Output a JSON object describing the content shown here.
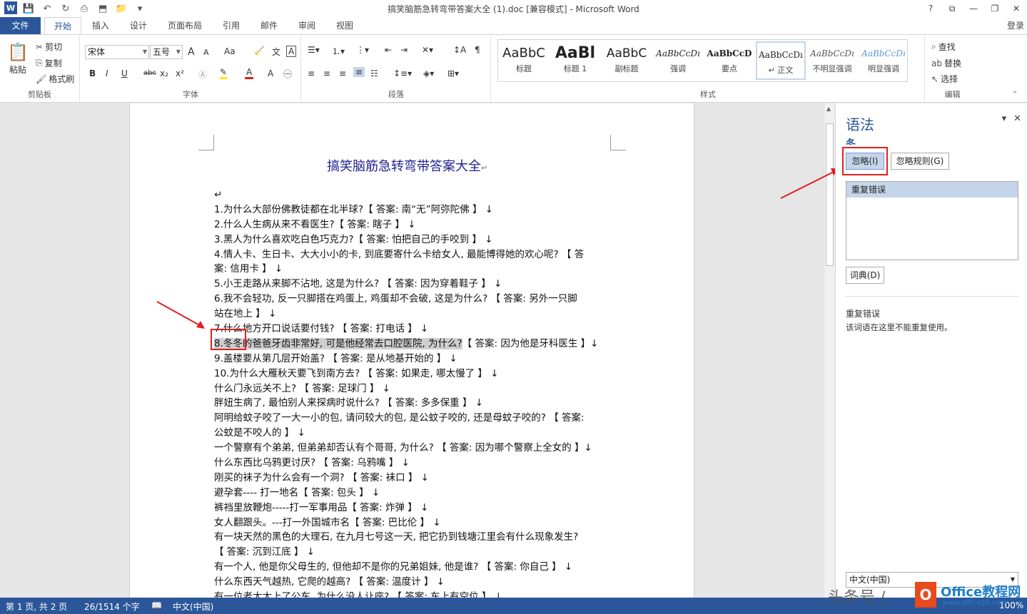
{
  "app": {
    "title": "搞笑脑筋急转弯带答案大全 (1).doc [兼容模式] - Microsoft Word",
    "window_controls": [
      "?",
      "⧉",
      "—",
      "❐",
      "✕"
    ],
    "login": "登录"
  },
  "tabs": [
    "文件",
    "开始",
    "插入",
    "设计",
    "页面布局",
    "引用",
    "邮件",
    "审阅",
    "视图"
  ],
  "ribbon": {
    "clipboard": {
      "paste": "粘贴",
      "cut": "剪切",
      "copy": "复制",
      "format_painter": "格式刷",
      "label": "剪贴板"
    },
    "font": {
      "name": "宋体",
      "size": "五号",
      "case": "Aa",
      "label": "字体",
      "fmt": [
        "B",
        "I",
        "U",
        "abc",
        "x₂",
        "x²"
      ],
      "grow": "A",
      "shrink": "A",
      "font_color": "A"
    },
    "paragraph": {
      "label": "段落"
    },
    "styles": {
      "label": "样式",
      "items": [
        {
          "sample": "AaBbC",
          "name": "标题"
        },
        {
          "sample": "AaBl",
          "name": "标题 1"
        },
        {
          "sample": "AaBbC",
          "name": "副标题"
        },
        {
          "sample": "AaBbCcDı",
          "name": "强调"
        },
        {
          "sample": "AaBbCcD",
          "name": "要点"
        },
        {
          "sample": "AaBbCcDı",
          "name": "↵ 正文"
        },
        {
          "sample": "AaBbCcDı",
          "name": "不明显强调"
        },
        {
          "sample": "AaBbCcDı",
          "name": "明显强调"
        }
      ]
    },
    "editing": {
      "find": "查找",
      "replace": "替换",
      "select": "选择",
      "label": "编辑"
    }
  },
  "document": {
    "heading": "搞笑脑筋急转弯带答案大全",
    "lines": [
      "↵",
      "1.为什么大部份佛教徒都在北半球?【 答案: 南“无”阿弥陀佛 】 ↓",
      "2.什么人生病从来不看医生?【 答案: 瞎子 】 ↓",
      "3.黑人为什么喜欢吃白色巧克力?【 答案: 怕把自己的手咬到 】 ↓",
      "4.情人卡、生日卡、大大小小的卡, 到底要寄什么卡给女人, 最能博得她的欢心呢? 【 答",
      "案: 信用卡 】 ↓",
      "5.小王走路从来脚不沾地, 这是为什么? 【 答案: 因为穿着鞋子 】 ↓",
      "6.我不会轻功, 反一只脚搭在鸡蛋上, 鸡蛋却不会破, 这是为什么? 【 答案: 另外一只脚",
      "站在地上 】 ↓",
      "7.什么地方开口说话要付钱? 【 答案: 打电话 】 ↓",
      "8.冬冬的爸爸牙齿非常好, 可是他经常去口腔医院, 为什么? 【 答案: 因为他是牙科医生 】↓",
      "9.盖楼要从第几层开始盖? 【 答案: 是从地基开始的 】 ↓",
      "10.为什么大雁秋天要飞到南方去? 【 答案: 如果走, 哪太慢了 】 ↓",
      "什么门永远关不上? 【 答案: 足球门 】 ↓",
      "胖妞生病了, 最怕别人来探病时说什么? 【 答案: 多多保重 】 ↓",
      "阿明给蚊子咬了一大一小的包, 请问较大的包, 是公蚊子咬的, 还是母蚊子咬的? 【 答案:",
      "公蚊是不咬人的 】 ↓",
      "一个警察有个弟弟, 但弟弟却否认有个哥哥, 为什么? 【 答案: 因为哪个警察上全女的 】↓",
      "什么东西比乌鸦更讨厌? 【 答案: 乌鸦嘴 】 ↓",
      "刚买的袜子为什么会有一个洞? 【 答案: 袜口 】 ↓",
      "避孕套---- 打一地名【 答案: 包头 】 ↓",
      "裤裆里放鞭炮-----打一军事用品【 答案: 炸弹 】 ↓",
      "女人翻跟头。---打一外国城市名【 答案: 巴比伦 】 ↓",
      "有一块天然的黑色的大理石, 在九月七号这一天, 把它扔到钱塘江里会有什么现象发生?",
      "【 答案: 沉到江底 】 ↓",
      "有一个人, 他是你父母生的, 但他却不是你的兄弟姐妹, 他是谁? 【 答案: 你自己 】 ↓",
      "什么东西天气越热, 它爬的越高? 【 答案: 温度计 】 ↓",
      "有一位老太太上了公车, 为什么没人让座? 【 答案: 车上有空位 】 ↓"
    ],
    "highlight_line_text": "8.冬冬的爸爸牙齿非常好, 可是他经常去口腔医院, 为什么?",
    "highlight_line_rest": "【 答案: 因为他是牙科医生 】↓"
  },
  "pane": {
    "title": "语法",
    "word": "冬",
    "ignore": "忽略(I)",
    "ignore_rule": "忽略规则(G)",
    "suggestion": "重复错误",
    "dictionary": "词典(D)",
    "explain_title": "重复错误",
    "explain_text": "该词语在这里不能重复使用。",
    "language": "中文(中国)"
  },
  "status": {
    "page": "第 1 页, 共 2 页",
    "words": "26/1514 个字",
    "lang": "中文(中国)",
    "zoom": "100%"
  },
  "watermark": {
    "text1": "头条号 /",
    "text2": "Office教程网",
    "url": "www.office26.com"
  },
  "colors": {
    "accent": "#2b579a",
    "annotation": "#e02020",
    "highlight": "#cfcfcf"
  }
}
